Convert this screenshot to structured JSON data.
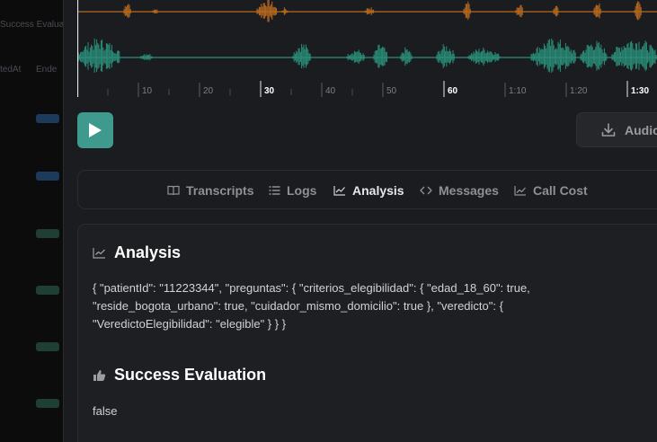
{
  "backdrop": {
    "text1": "Success Evaluat",
    "text2": "tedAt",
    "text3": "Ende",
    "pill_colors": [
      "#1d3a5a",
      "#1d3a5a",
      "#1f3f34",
      "#1f3f34",
      "#1f3f34",
      "#1f3f34"
    ]
  },
  "waveform": {
    "assistant_color": "#b86a1f",
    "user_color": "#2a8f7a",
    "timeline": [
      "10",
      "20",
      "30",
      "40",
      "50",
      "60",
      "1:10",
      "1:20",
      "1:30"
    ],
    "major_labels": [
      "30",
      "60",
      "1:30"
    ]
  },
  "player": {
    "audio_label": "Audio"
  },
  "tabs": [
    {
      "label": "Transcripts",
      "icon": "book-icon"
    },
    {
      "label": "Logs",
      "icon": "list-icon"
    },
    {
      "label": "Analysis",
      "icon": "chart-icon"
    },
    {
      "label": "Messages",
      "icon": "code-icon"
    },
    {
      "label": "Call Cost",
      "icon": "cost-chart-icon"
    }
  ],
  "active_tab": "Analysis",
  "analysis": {
    "title": "Analysis",
    "json_text": "{ \"patientId\": \"11223344\", \"preguntas\": { \"criterios_elegibilidad\": { \"edad_18_60\": true, \"reside_bogota_urbano\": true, \"cuidador_mismo_domicilio\": true }, \"veredicto\": { \"VeredictoElegibilidad\": \"elegible\" } } }"
  },
  "success_evaluation": {
    "title": "Success Evaluation",
    "value": "false"
  },
  "colors": {
    "accent": "#3d9a8c",
    "panel_bg": "#1b1c1f",
    "card_bg": "#1e1f23"
  }
}
